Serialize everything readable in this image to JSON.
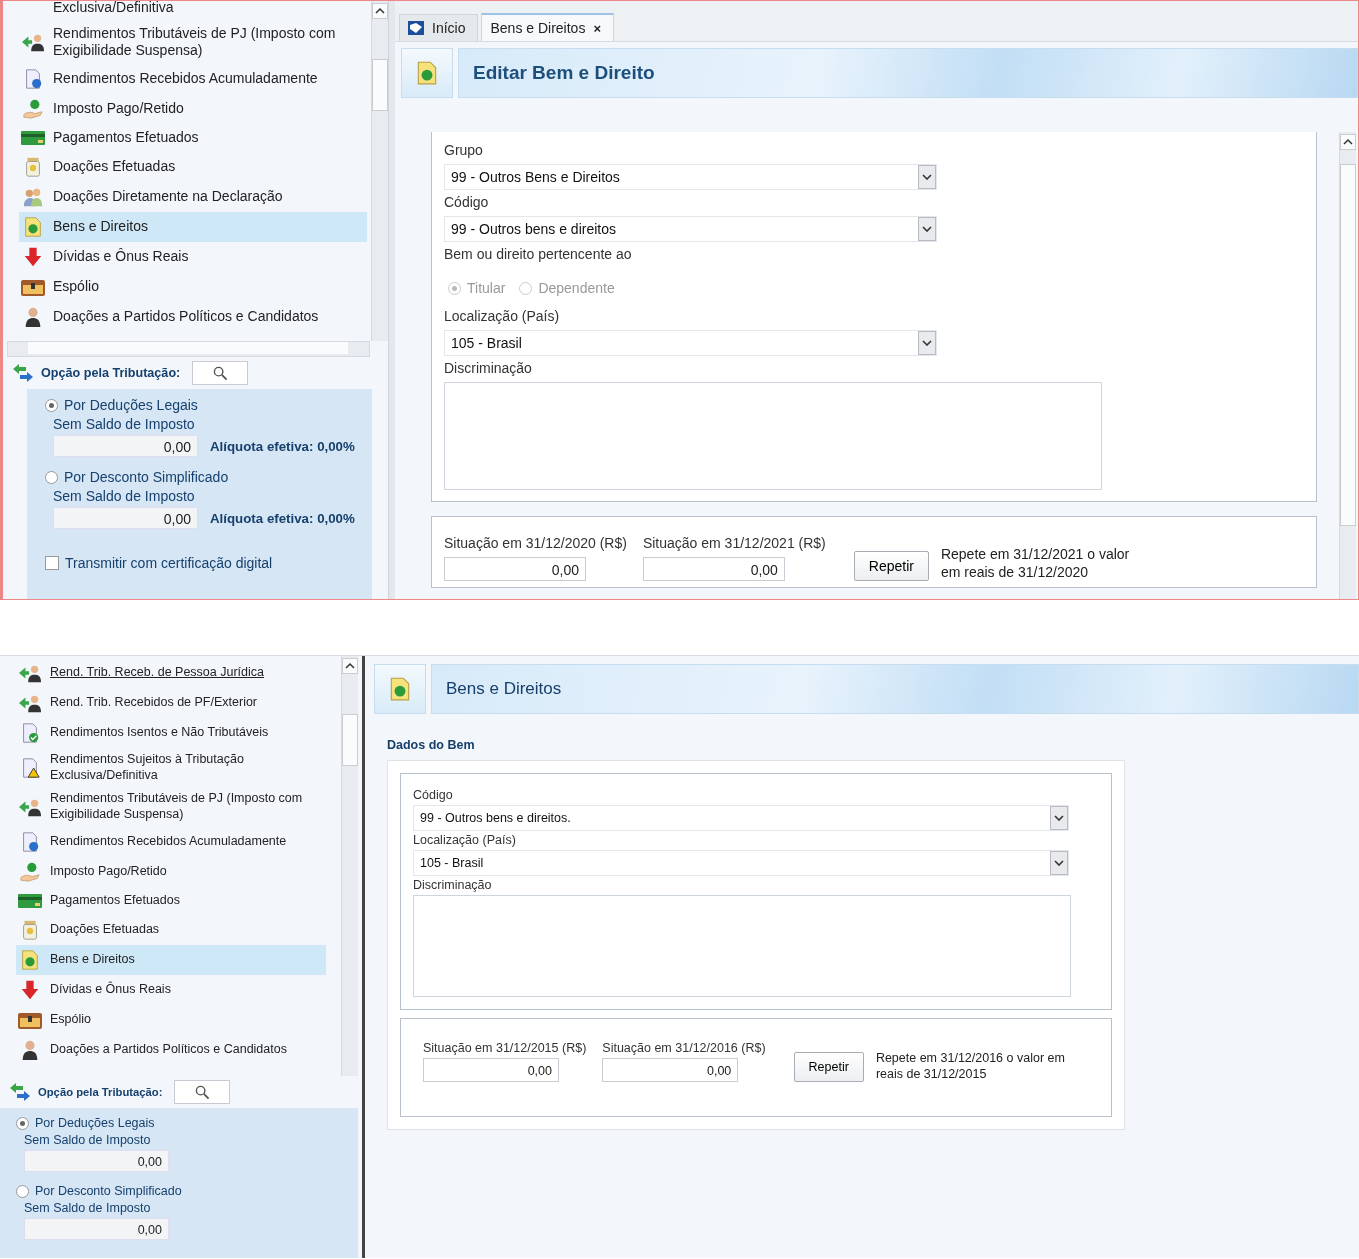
{
  "screens": [
    {
      "nav": {
        "items": [
          {
            "label": "Exclusiva/Definitiva",
            "selected": false,
            "underlined": false
          },
          {
            "label": "Rendimentos Tributáveis de PJ (Imposto com Exigibilidade Suspensa)",
            "selected": false,
            "underlined": false
          },
          {
            "label": "Rendimentos Recebidos Acumuladamente",
            "selected": false,
            "underlined": false
          },
          {
            "label": "Imposto Pago/Retido",
            "selected": false,
            "underlined": false
          },
          {
            "label": "Pagamentos Efetuados",
            "selected": false,
            "underlined": false
          },
          {
            "label": "Doações Efetuadas",
            "selected": false,
            "underlined": false
          },
          {
            "label": "Doações Diretamente na Declaração",
            "selected": false,
            "underlined": false
          },
          {
            "label": "Bens e Direitos",
            "selected": true,
            "underlined": false
          },
          {
            "label": "Dívidas e Ônus Reais",
            "selected": false,
            "underlined": false
          },
          {
            "label": "Espólio",
            "selected": false,
            "underlined": false
          },
          {
            "label": "Doações a Partidos Políticos e Candidatos",
            "selected": false,
            "underlined": false
          }
        ]
      },
      "taxation": {
        "title": "Opção pela Tributação:",
        "options": [
          {
            "label": "Por Deduções Legais",
            "selected": true,
            "sublabel": "Sem Saldo de Imposto",
            "value": "0,00",
            "rate": "Alíquota efetiva: 0,00%"
          },
          {
            "label": "Por Desconto Simplificado",
            "selected": false,
            "sublabel": "Sem Saldo de Imposto",
            "value": "0,00",
            "rate": "Alíquota efetiva: 0,00%"
          }
        ],
        "certificate": {
          "label": "Transmitir com certificação digital",
          "checked": false
        }
      },
      "tabs": [
        {
          "label": "Início",
          "selected": false
        },
        {
          "label": "Bens e Direitos",
          "selected": true,
          "close": "×"
        }
      ],
      "header": "Editar Bem e Direito",
      "fields": [
        {
          "kind": "select",
          "label": "Grupo",
          "value": "99 - Outros Bens e Direitos"
        },
        {
          "kind": "select",
          "label": "Código",
          "value": "99 - Outros bens e direitos"
        },
        {
          "kind": "radio",
          "label": "Bem ou direito pertencente ao",
          "disabled": true,
          "options": [
            {
              "label": "Titular",
              "selected": true
            },
            {
              "label": "Dependente",
              "selected": false
            }
          ]
        },
        {
          "kind": "select",
          "label": "Localização (País)",
          "value": "105 - Brasil"
        },
        {
          "kind": "textarea",
          "label": "Discriminação"
        }
      ],
      "balances": [
        {
          "label": "Situação em 31/12/2020 (R$)",
          "value": "0,00"
        },
        {
          "label": "Situação em 31/12/2021 (R$)",
          "value": "0,00"
        }
      ],
      "repeat_button": "Repetir",
      "repeat_note": "Repete em 31/12/2021 o valor em reais de 31/12/2020"
    },
    {
      "nav": {
        "items": [
          {
            "label": "Rend. Trib. Receb. de Pessoa Jurídica",
            "selected": false,
            "underlined": true
          },
          {
            "label": "Rend. Trib. Recebidos de PF/Exterior",
            "selected": false,
            "underlined": false
          },
          {
            "label": "Rendimentos Isentos e Não Tributáveis",
            "selected": false,
            "underlined": false
          },
          {
            "label": "Rendimentos Sujeitos à Tributação Exclusiva/Definitiva",
            "selected": false,
            "underlined": false
          },
          {
            "label": "Rendimentos Tributáveis de PJ (Imposto com Exigibilidade Suspensa)",
            "selected": false,
            "underlined": false
          },
          {
            "label": "Rendimentos Recebidos Acumuladamente",
            "selected": false,
            "underlined": false
          },
          {
            "label": "Imposto Pago/Retido",
            "selected": false,
            "underlined": false
          },
          {
            "label": "Pagamentos Efetuados",
            "selected": false,
            "underlined": false
          },
          {
            "label": "Doações Efetuadas",
            "selected": false,
            "underlined": false
          },
          {
            "label": "Bens e Direitos",
            "selected": true,
            "underlined": false
          },
          {
            "label": "Dívidas e Ônus Reais",
            "selected": false,
            "underlined": false
          },
          {
            "label": "Espólio",
            "selected": false,
            "underlined": false
          },
          {
            "label": "Doações a Partidos Políticos e Candidatos",
            "selected": false,
            "underlined": false
          }
        ]
      },
      "taxation": {
        "title": "Opção pela Tributação:",
        "options": [
          {
            "label": "Por Deduções Legais",
            "selected": true,
            "sublabel": "Sem Saldo de Imposto",
            "value": "0,00"
          },
          {
            "label": "Por Desconto Simplificado",
            "selected": false,
            "sublabel": "Sem Saldo de Imposto",
            "value": "0,00"
          }
        ]
      },
      "header": "Bens e Direitos",
      "section_title": "Dados do Bem",
      "fields": [
        {
          "kind": "select",
          "label": "Código",
          "value": "99 - Outros bens e direitos."
        },
        {
          "kind": "select",
          "label": "Localização (País)",
          "value": "105 - Brasil"
        },
        {
          "kind": "textarea",
          "label": "Discriminação"
        }
      ],
      "balances": [
        {
          "label": "Situação em 31/12/2015 (R$)",
          "value": "0,00"
        },
        {
          "label": "Situação em 31/12/2016 (R$)",
          "value": "0,00"
        }
      ],
      "repeat_button": "Repetir",
      "repeat_note": "Repete em 31/12/2016 o valor em reais de 31/12/2015"
    }
  ]
}
